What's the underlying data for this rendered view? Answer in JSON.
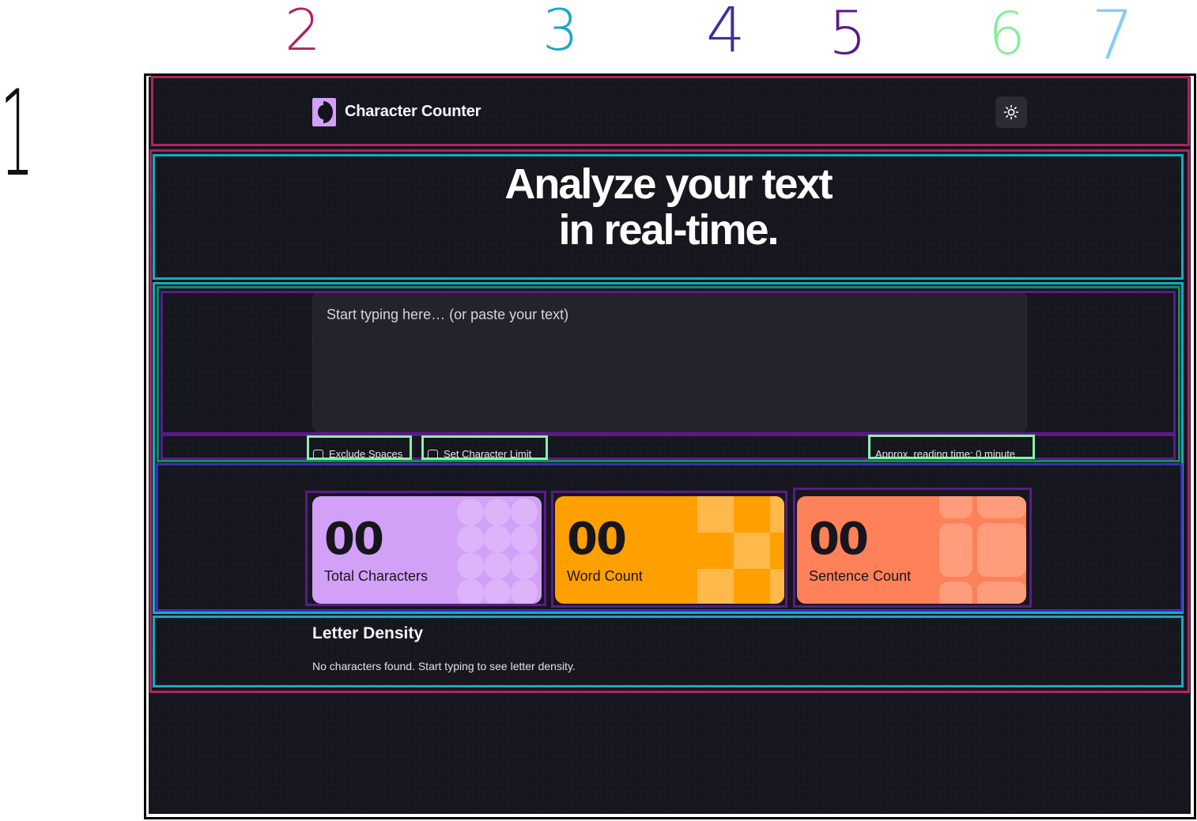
{
  "annotations": [
    "1",
    "2",
    "3",
    "4",
    "5",
    "6",
    "7"
  ],
  "header": {
    "app_title": "Character Counter",
    "theme_toggle_icon": "sun-icon"
  },
  "hero": {
    "line1": "Analyze your text",
    "line2": "in real-time."
  },
  "editor": {
    "placeholder": "Start typing here… (or paste your text)",
    "value": ""
  },
  "options": {
    "exclude_spaces": "Exclude Spaces",
    "character_limit": "Set Character Limit",
    "reading_time": "Approx. reading time: 0 minute"
  },
  "stats": [
    {
      "value": "00",
      "label": "Total Characters",
      "color": "#d3a0f8"
    },
    {
      "value": "00",
      "label": "Word Count",
      "color": "#ff9f00"
    },
    {
      "value": "00",
      "label": "Sentence Count",
      "color": "#fe8159"
    }
  ],
  "letter_density": {
    "title": "Letter Density",
    "empty_message": "No characters found. Start typing to see letter density."
  },
  "colors": {
    "background": "#14141c",
    "surface": "#23232c",
    "accent": "#d3a0f8"
  }
}
